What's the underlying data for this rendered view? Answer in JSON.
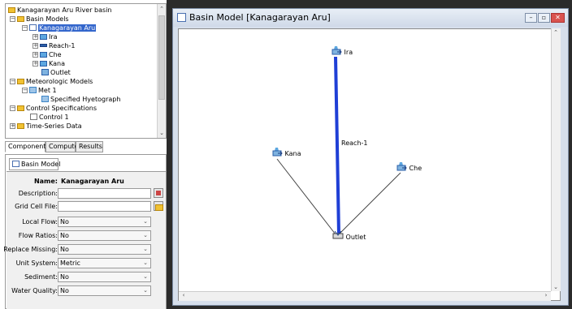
{
  "tree": {
    "root": "Kanagarayan Aru River basin",
    "basin_models": "Basin Models",
    "basin_selected": "Kanagarayan Aru",
    "elements": [
      "Ira",
      "Reach-1",
      "Che",
      "Kana",
      "Outlet"
    ],
    "meteorologic_models": "Meteorologic Models",
    "met_1": "Met 1",
    "specified_hyetograph": "Specified Hyetograph",
    "control_specifications": "Control Specifications",
    "control_1": "Control 1",
    "time_series_data": "Time-Series Data"
  },
  "left_tabs": [
    "Components",
    "Compute",
    "Results"
  ],
  "properties": {
    "tab": "Basin Model",
    "name_label": "Name:",
    "name_value": "Kanagarayan Aru",
    "rows": [
      {
        "label": "Description:",
        "value": ""
      },
      {
        "label": "Grid Cell File:",
        "value": ""
      },
      {
        "label": "Local Flow:",
        "value": "No"
      },
      {
        "label": "Flow Ratios:",
        "value": "No"
      },
      {
        "label": "Replace Missing:",
        "value": "No"
      },
      {
        "label": "Unit System:",
        "value": "Metric"
      },
      {
        "label": "Sediment:",
        "value": "No"
      },
      {
        "label": "Water Quality:",
        "value": "No"
      }
    ]
  },
  "window": {
    "title": "Basin Model [Kanagarayan Aru]",
    "min": "–",
    "max": "▫",
    "close": "✕"
  },
  "map": {
    "ira": "Ira",
    "kana": "Kana",
    "che": "Che",
    "outlet": "Outlet",
    "reach": "Reach-1"
  },
  "colors": {
    "reach": "#1f3fd6",
    "selection": "#3366cc"
  }
}
